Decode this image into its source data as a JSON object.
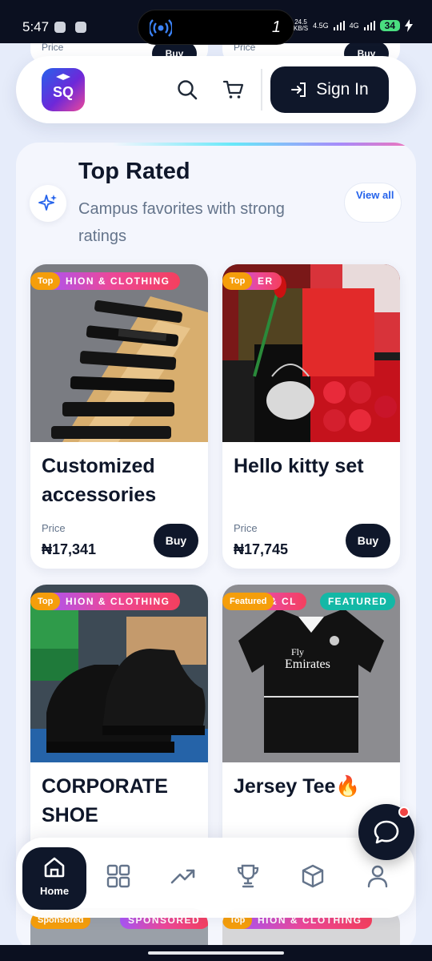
{
  "status_bar": {
    "time": "5:47",
    "island_number": "1",
    "net_speed_value": "24.5",
    "net_speed_unit": "KB/S",
    "network_1": "4.5G",
    "network_2": "4G",
    "battery": "34"
  },
  "ghost_cards": [
    {
      "price_label": "Price",
      "buy_label": "Buy"
    },
    {
      "price_label": "Price",
      "buy_label": "Buy"
    }
  ],
  "header": {
    "logo_text": "SQ",
    "signin_label": "Sign In"
  },
  "section": {
    "title": "Top Rated",
    "subtitle": "Campus favorites with strong ratings",
    "view_all": "View all"
  },
  "products": [
    {
      "name": "Customized accessories",
      "price_label": "Price",
      "price": "₦17,341",
      "buy": "Buy",
      "category": "HION & CLOTHING",
      "tag": "Top"
    },
    {
      "name": "Hello kitty set",
      "price_label": "Price",
      "price": "₦17,745",
      "buy": "Buy",
      "category": "ER",
      "tag": "Top"
    },
    {
      "name": "CORPORATE SHOE",
      "category": "HION & CLOTHING",
      "tag": "Top"
    },
    {
      "name": "Jersey Tee🔥",
      "category": "N & CL",
      "tag": "Featured",
      "featured": "FEATURED"
    }
  ],
  "bottom_peek": [
    {
      "tag": "Sponsored",
      "category": "& C",
      "sponsored": "SPONSORED"
    },
    {
      "tag": "Top",
      "category": "HION & CLOTHING"
    }
  ],
  "nav": {
    "home_label": "Home",
    "items": [
      "categories",
      "trending",
      "trophy",
      "box",
      "profile"
    ]
  },
  "colors": {
    "primary": "#0f172a",
    "accent": "#2563eb",
    "badge_orange": "#f59e0b",
    "badge_teal": "#14b8a6"
  }
}
